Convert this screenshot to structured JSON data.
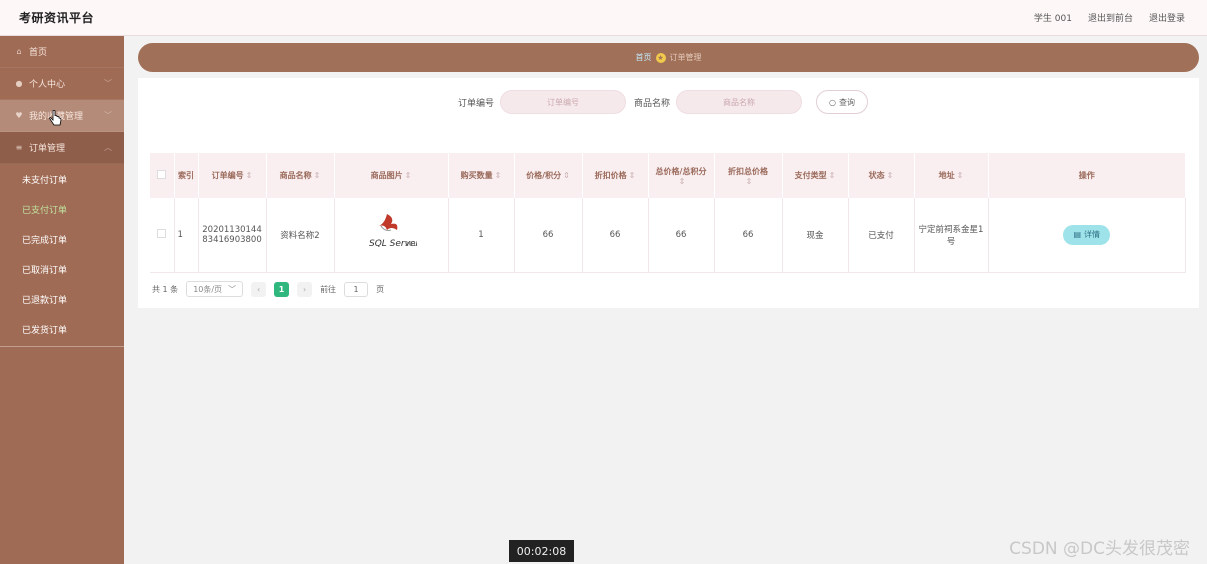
{
  "header": {
    "title": "考研资讯平台",
    "user": "学生 001",
    "back_front": "退出到前台",
    "logout": "退出登录"
  },
  "sidebar": {
    "items": [
      {
        "label": "首页",
        "icon": "home-icon"
      },
      {
        "label": "个人中心",
        "icon": "user-icon"
      },
      {
        "label": "我的收藏管理",
        "icon": "heart-icon"
      },
      {
        "label": "订单管理",
        "icon": "list-icon"
      }
    ],
    "sub_items": [
      {
        "label": "未支付订单"
      },
      {
        "label": "已支付订单"
      },
      {
        "label": "已完成订单"
      },
      {
        "label": "已取消订单"
      },
      {
        "label": "已退款订单"
      },
      {
        "label": "已发货订单"
      }
    ]
  },
  "breadcrumb": {
    "home": "首页",
    "current": "订单管理"
  },
  "search": {
    "order_label": "订单编号",
    "order_placeholder": "订单编号",
    "goods_label": "商品名称",
    "goods_placeholder": "商品名称",
    "query_button": "查询"
  },
  "table": {
    "headers": [
      "索引",
      "订单编号",
      "商品名称",
      "商品图片",
      "购买数量",
      "价格/积分",
      "折扣价格",
      "总价格/总积分",
      "折扣总价格",
      "支付类型",
      "状态",
      "地址",
      "操作"
    ],
    "rows": [
      {
        "index": "1",
        "order_no": "2020113014483416903800",
        "goods": "资料名称2",
        "qty": "1",
        "price": "66",
        "discount_price": "66",
        "total": "66",
        "discount_total": "66",
        "pay_type": "现金",
        "status": "已支付",
        "address": "宁定前祠系金星1号",
        "action": "详情"
      }
    ]
  },
  "image_logo": {
    "brand": "SQL Server",
    "version": "2012"
  },
  "pagination": {
    "total": "共 1 条",
    "page_size": "10条/页",
    "current": "1",
    "goto_label": "前往",
    "goto_value": "1",
    "page_unit": "页"
  },
  "overlay": {
    "timestamp": "00:02:08",
    "watermark": "CSDN @DC头发很茂密"
  },
  "colors": {
    "sidebar_bg": "#a06b55",
    "accent_green": "#2fb77e",
    "detail_button": "#9ee3ea"
  }
}
